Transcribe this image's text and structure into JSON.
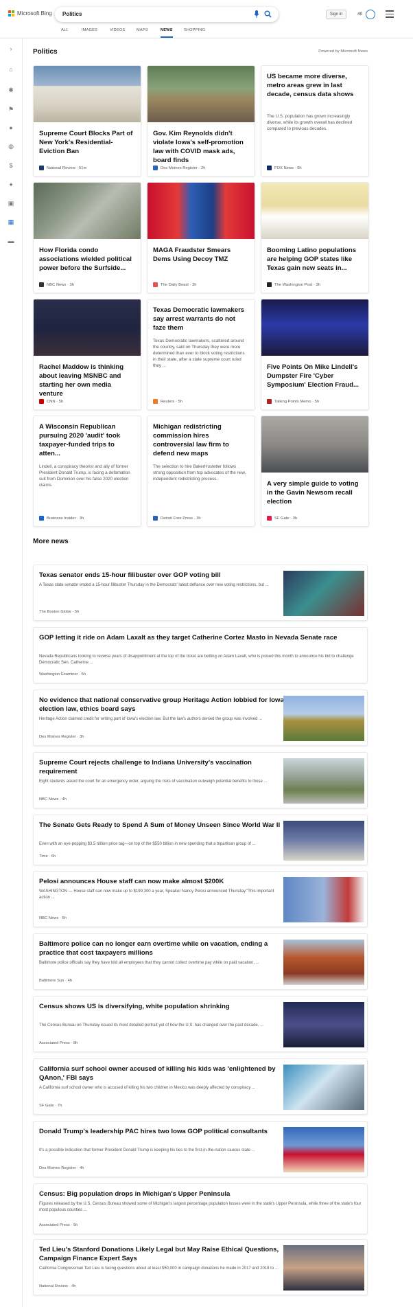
{
  "header": {
    "brand": "Microsoft Bing",
    "search_value": "Politics",
    "signin": "Sign in",
    "reward_points": "40"
  },
  "tabs": [
    "ALL",
    "IMAGES",
    "VIDEOS",
    "MAPS",
    "NEWS",
    "SHOPPING"
  ],
  "active_tab": "NEWS",
  "section": {
    "title": "Politics",
    "powered": "Powered by Microsoft News"
  },
  "cards": [
    {
      "title": "Supreme Court Blocks Part of New York's Residential-Eviction Ban",
      "summary": "",
      "source": "National Review",
      "time": "51m"
    },
    {
      "title": "Gov. Kim Reynolds didn't violate Iowa's self-promotion law with COVID mask ads, board finds",
      "summary": "",
      "source": "Des Moines Register",
      "time": "2h"
    },
    {
      "title": "US became more diverse, metro areas grew in last decade, census data shows",
      "summary": "The U.S. population has grown increasingly diverse, while its growth overall has declined compared to previous decades.",
      "source": "FOX News",
      "time": "6h"
    },
    {
      "title": "How Florida condo associations wielded political power before the Surfside...",
      "summary": "",
      "source": "NBC News",
      "time": "3h"
    },
    {
      "title": "MAGA Fraudster Smears Dems Using Decoy TMZ",
      "summary": "",
      "source": "The Daily Beast",
      "time": "3h"
    },
    {
      "title": "Booming Latino populations are helping GOP states like Texas gain new seats in...",
      "summary": "",
      "source": "The Washington Post",
      "time": "3h"
    },
    {
      "title": "Rachel Maddow is thinking about leaving MSNBC and starting her own media venture",
      "summary": "",
      "source": "CNN",
      "time": "5h"
    },
    {
      "title": "Texas Democratic lawmakers say arrest warrants do not faze them",
      "summary": "Texas Democratic lawmakers, scattered around the country, said on Thursday they were more determined than ever to block voting restrictions in their state, after a state supreme court ruled they ...",
      "source": "Reuters",
      "time": "5h"
    },
    {
      "title": "Five Points On Mike Lindell's Dumpster Fire 'Cyber Symposium' Election Fraud...",
      "summary": "",
      "source": "Talking Points Memo",
      "time": "5h"
    },
    {
      "title": "A Wisconsin Republican pursuing 2020 'audit' took taxpayer-funded trips to atten...",
      "summary": "Lindell, a conspiracy theorist and ally of former President Donald Trump, is facing a defamation suit from Dominion over his false 2020 election claims.",
      "source": "Business Insider",
      "time": "3h"
    },
    {
      "title": "Michigan redistricting commission hires controversial law firm to defend new maps",
      "summary": "The selection to hire BakerHostetler follows strong opposition from top advocates of the new, independent redistricting process.",
      "source": "Detroit Free Press",
      "time": "3h"
    },
    {
      "title": "A very simple guide to voting in the Gavin Newsom recall election",
      "summary": "",
      "source": "SF Gate",
      "time": "3h"
    }
  ],
  "more_title": "More news",
  "more": [
    {
      "title": "Texas senator ends 15-hour filibuster over GOP voting bill",
      "summary": "A Texas state senator ended a 15-hour filibuster Thursday in the Democrats' latest defiance over new voting restrictions, but ...",
      "source": "The Boston Globe",
      "time": "5h"
    },
    {
      "title": "GOP letting it ride on Adam Laxalt as they target Catherine Cortez Masto in Nevada Senate race",
      "summary": "Nevada Republicans looking to reverse years of disappointment at the top of the ticket are betting on Adam Laxalt, who is poised this month to announce his bid to challenge Democratic Sen. Catherine ...",
      "source": "Washington Examiner",
      "time": "5h"
    },
    {
      "title": "No evidence that national conservative group Heritage Action lobbied for Iowa election law, ethics board says",
      "summary": "Heritage Action claimed credit for writing part of Iowa's election law. But the law's authors denied the group was involved ...",
      "source": "Des Moines Register",
      "time": "3h"
    },
    {
      "title": "Supreme Court rejects challenge to Indiana University's vaccination requirement",
      "summary": "Eight students asked the court for an emergency order, arguing the risks of vaccination outweigh potential benefits to those ...",
      "source": "NBC News",
      "time": "4h"
    },
    {
      "title": "The Senate Gets Ready to Spend A Sum of Money Unseen Since World War II",
      "summary": "Even with an eye-popping $3.5 trillion price tag—on top of the $550 billion in new spending that a bipartisan group of ...",
      "source": "Time",
      "time": "6h"
    },
    {
      "title": "Pelosi announces House staff can now make almost $200K",
      "summary": "WASHINGTON — House staff can now make up to $199,300 a year, Speaker Nancy Pelosi announced Thursday.\"This important action ...",
      "source": "NBC News",
      "time": "6h"
    },
    {
      "title": "Baltimore police can no longer earn overtime while on vacation, ending a practice that cost taxpayers millions",
      "summary": "Baltimore police officials say they have told all employees that they cannot collect overtime pay while on paid vacation, ...",
      "source": "Baltimore Sun",
      "time": "4h"
    },
    {
      "title": "Census shows US is diversifying, white population shrinking",
      "summary": "The Census Bureau on Thursday issued its most detailed portrait yet of how the U.S. has changed over the past decade, ...",
      "source": "Associated Press",
      "time": "8h"
    },
    {
      "title": "California surf school owner accused of killing his kids was 'enlightened by QAnon,' FBI says",
      "summary": "A California surf school owner who is accused of killing his two children in Mexico was deeply affected by conspiracy ...",
      "source": "SF Gate",
      "time": "7h"
    },
    {
      "title": "Donald Trump's leadership PAC hires two Iowa GOP political consultants",
      "summary": "It's a possible indication that former President Donald Trump is keeping his ties to the first-in-the-nation caucus state ...",
      "source": "Des Moines Register",
      "time": "4h"
    },
    {
      "title": "Census: Big population drops in Michigan's Upper Peninsula",
      "summary": "Figures released by the U.S. Census Bureau showed some of Michigan's largest percentage population losses were in the state's Upper Peninsula, while three of the state's four most populous counties ...",
      "source": "Associated Press",
      "time": "5h"
    },
    {
      "title": "Ted Lieu's Stanford Donations Likely Legal but May Raise Ethical Questions, Campaign Finance Expert Says",
      "summary": "California Congressman Ted Lieu is facing questions about at least $50,000 in campaign donations he made in 2017 and 2018 to ...",
      "source": "National Review",
      "time": "4h"
    }
  ]
}
